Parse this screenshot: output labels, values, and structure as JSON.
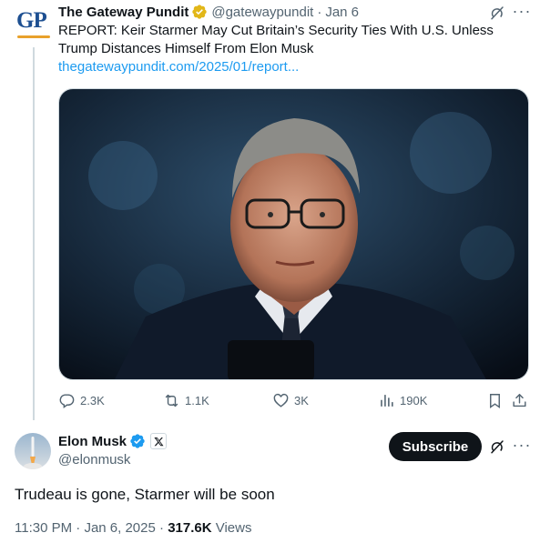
{
  "colors": {
    "accent": "#1d9bf0",
    "text": "#0f1419",
    "muted": "#536471",
    "gold_badge": "#e2b719",
    "blue_badge": "#1d9bf0"
  },
  "quoted_tweet": {
    "avatar_text": "GP",
    "display_name": "The Gateway Pundit",
    "badge_icon": "gold-verified-badge",
    "handle": "@gatewaypundit",
    "separator": "·",
    "date": "Jan 6",
    "text": "REPORT: Keir Starmer May Cut Britain’s Security Ties With U.S. Unless Trump Distances Himself From Elon Musk",
    "link": "thegatewaypundit.com/2025/01/report...",
    "actions": {
      "replies": "2.3K",
      "reposts": "1.1K",
      "likes": "3K",
      "views": "190K"
    }
  },
  "main_tweet": {
    "display_name": "Elon Musk",
    "badge_icon": "blue-verified-badge",
    "affiliate_icon": "x-logo-icon",
    "handle": "@elonmusk",
    "subscribe_label": "Subscribe",
    "more_label": "···",
    "text": "Trudeau is gone, Starmer will be soon",
    "time": "11:30 PM",
    "date": "Jan 6, 2025",
    "separator": "·",
    "views_count": "317.6K",
    "views_label": "Views"
  },
  "top_more_label": "···"
}
